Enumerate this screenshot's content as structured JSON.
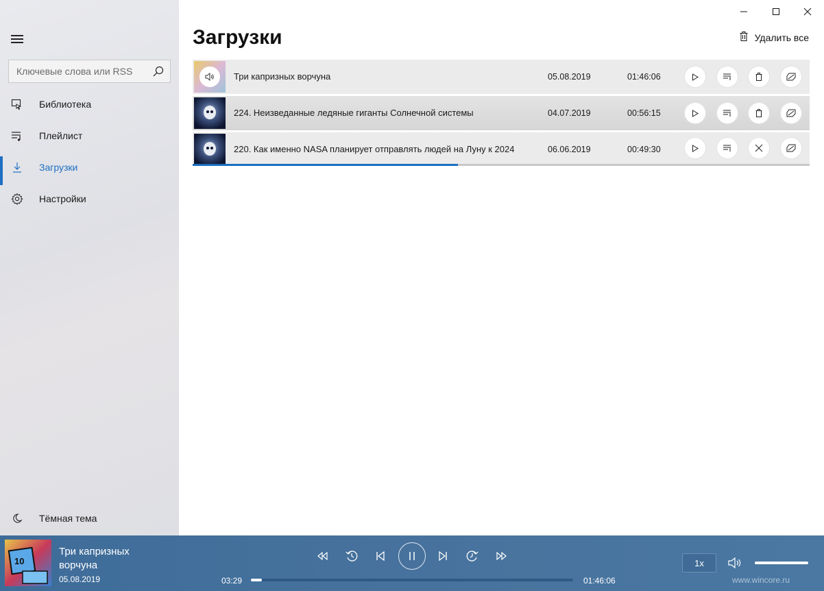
{
  "window": {
    "controls": [
      "minimize",
      "maximize",
      "close"
    ]
  },
  "sidebar": {
    "search": {
      "placeholder": "Ключевые слова или RSS",
      "value": ""
    },
    "items": [
      {
        "label": "Библиотека",
        "icon": "library-icon",
        "active": false
      },
      {
        "label": "Плейлист",
        "icon": "playlist-icon",
        "active": false
      },
      {
        "label": "Загрузки",
        "icon": "download-icon",
        "active": true
      },
      {
        "label": "Настройки",
        "icon": "gear-icon",
        "active": false
      }
    ],
    "theme_toggle": {
      "label": "Тёмная тема",
      "icon": "moon-icon"
    }
  },
  "main": {
    "title": "Загрузки",
    "delete_all_label": "Удалить все",
    "downloads": [
      {
        "title": "Три капризных ворчуна",
        "date": "05.08.2019",
        "duration": "01:46:06",
        "now_playing": true,
        "status": "downloaded"
      },
      {
        "title": "224. Неизведанные ледяные гиганты Солнечной системы",
        "date": "04.07.2019",
        "duration": "00:56:15",
        "now_playing": false,
        "status": "downloaded"
      },
      {
        "title": "220. Как именно NASA планирует отправлять людей на Луну к 2024",
        "date": "06.06.2019",
        "duration": "00:49:30",
        "now_playing": false,
        "status": "downloading",
        "progress": 0.43
      }
    ]
  },
  "player": {
    "title": "Три капризных ворчуна",
    "date": "05.08.2019",
    "elapsed": "03:29",
    "total": "01:46:06",
    "position_fraction": 0.033,
    "speed": "1x",
    "volume_fraction": 1.0,
    "watermark": "www.wincore.ru"
  },
  "colors": {
    "accent": "#1f6fc2",
    "player_bg": "#46729d"
  }
}
